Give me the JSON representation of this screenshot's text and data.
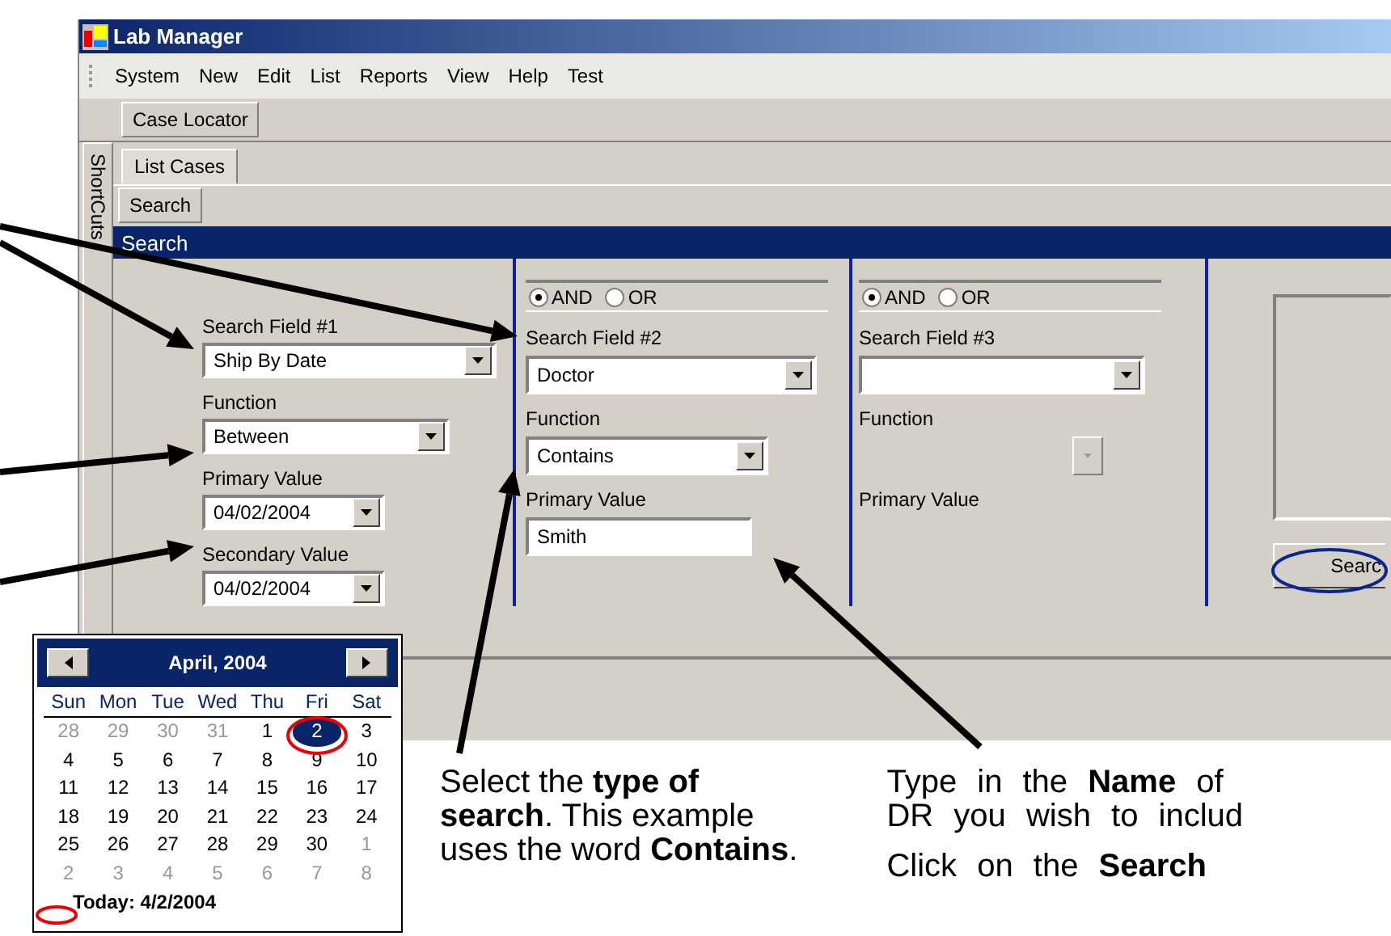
{
  "window": {
    "title": "Lab Manager"
  },
  "menu": [
    "System",
    "New",
    "Edit",
    "List",
    "Reports",
    "View",
    "Help",
    "Test"
  ],
  "toolbar": {
    "button": "Case Locator"
  },
  "sidebar": {
    "label": "ShortCuts"
  },
  "tabs": [
    {
      "label": "List Cases",
      "selected": true
    }
  ],
  "subtab": "Search",
  "panel_title": "Search",
  "search_fields": [
    {
      "kind": "date",
      "label": "Search Field #1",
      "field": "Ship By Date",
      "function_label": "Function",
      "function": "Between",
      "function_disabled": false,
      "primary_label": "Primary Value",
      "primary": "04/02/2004",
      "secondary_label": "Secondary Value",
      "secondary": "04/02/2004"
    },
    {
      "kind": "text",
      "logic": [
        {
          "label": "AND",
          "selected": true
        },
        {
          "label": "OR",
          "selected": false
        }
      ],
      "label": "Search Field #2",
      "field": "Doctor",
      "function_label": "Function",
      "function": "Contains",
      "function_disabled": false,
      "primary_label": "Primary Value",
      "primary": "Smith"
    },
    {
      "kind": "blank",
      "logic": [
        {
          "label": "AND",
          "selected": true
        },
        {
          "label": "OR",
          "selected": false
        }
      ],
      "label": "Search Field #3",
      "function_label": "Function",
      "function_disabled": true,
      "primary_label": "Primary Value"
    }
  ],
  "search_button": "Searc",
  "calendar": {
    "month": "April, 2004",
    "weekdays": [
      "Sun",
      "Mon",
      "Tue",
      "Wed",
      "Thu",
      "Fri",
      "Sat"
    ],
    "days": [
      {
        "label": "28",
        "other_month": true,
        "selected": false
      },
      {
        "label": "29",
        "other_month": true,
        "selected": false
      },
      {
        "label": "30",
        "other_month": true,
        "selected": false
      },
      {
        "label": "31",
        "other_month": true,
        "selected": false
      },
      {
        "label": "1",
        "other_month": false,
        "selected": false
      },
      {
        "label": "2",
        "other_month": false,
        "selected": true
      },
      {
        "label": "3",
        "other_month": false,
        "selected": false
      },
      {
        "label": "4",
        "other_month": false,
        "selected": false
      },
      {
        "label": "5",
        "other_month": false,
        "selected": false
      },
      {
        "label": "6",
        "other_month": false,
        "selected": false
      },
      {
        "label": "7",
        "other_month": false,
        "selected": false
      },
      {
        "label": "8",
        "other_month": false,
        "selected": false
      },
      {
        "label": "9",
        "other_month": false,
        "selected": false
      },
      {
        "label": "10",
        "other_month": false,
        "selected": false
      },
      {
        "label": "11",
        "other_month": false,
        "selected": false
      },
      {
        "label": "12",
        "other_month": false,
        "selected": false
      },
      {
        "label": "13",
        "other_month": false,
        "selected": false
      },
      {
        "label": "14",
        "other_month": false,
        "selected": false
      },
      {
        "label": "15",
        "other_month": false,
        "selected": false
      },
      {
        "label": "16",
        "other_month": false,
        "selected": false
      },
      {
        "label": "17",
        "other_month": false,
        "selected": false
      },
      {
        "label": "18",
        "other_month": false,
        "selected": false
      },
      {
        "label": "19",
        "other_month": false,
        "selected": false
      },
      {
        "label": "20",
        "other_month": false,
        "selected": false
      },
      {
        "label": "21",
        "other_month": false,
        "selected": false
      },
      {
        "label": "22",
        "other_month": false,
        "selected": false
      },
      {
        "label": "23",
        "other_month": false,
        "selected": false
      },
      {
        "label": "24",
        "other_month": false,
        "selected": false
      },
      {
        "label": "25",
        "other_month": false,
        "selected": false
      },
      {
        "label": "26",
        "other_month": false,
        "selected": false
      },
      {
        "label": "27",
        "other_month": false,
        "selected": false
      },
      {
        "label": "28",
        "other_month": false,
        "selected": false
      },
      {
        "label": "29",
        "other_month": false,
        "selected": false
      },
      {
        "label": "30",
        "other_month": false,
        "selected": false
      },
      {
        "label": "1",
        "other_month": true,
        "selected": false
      },
      {
        "label": "2",
        "other_month": true,
        "selected": false
      },
      {
        "label": "3",
        "other_month": true,
        "selected": false
      },
      {
        "label": "4",
        "other_month": true,
        "selected": false
      },
      {
        "label": "5",
        "other_month": true,
        "selected": false
      },
      {
        "label": "6",
        "other_month": true,
        "selected": false
      },
      {
        "label": "7",
        "other_month": true,
        "selected": false
      },
      {
        "label": "8",
        "other_month": true,
        "selected": false
      }
    ],
    "today": "Today: 4/2/2004"
  },
  "callouts": [
    {
      "paragraphs": [
        [
          "Select the **type of**",
          "**search**. This  example",
          "uses the word **Contains**."
        ]
      ]
    },
    {
      "paragraphs": [
        [
          "Type in the **Name** of",
          "DR you wish to includ"
        ],
        [
          "Click on the **Search**"
        ]
      ]
    }
  ]
}
